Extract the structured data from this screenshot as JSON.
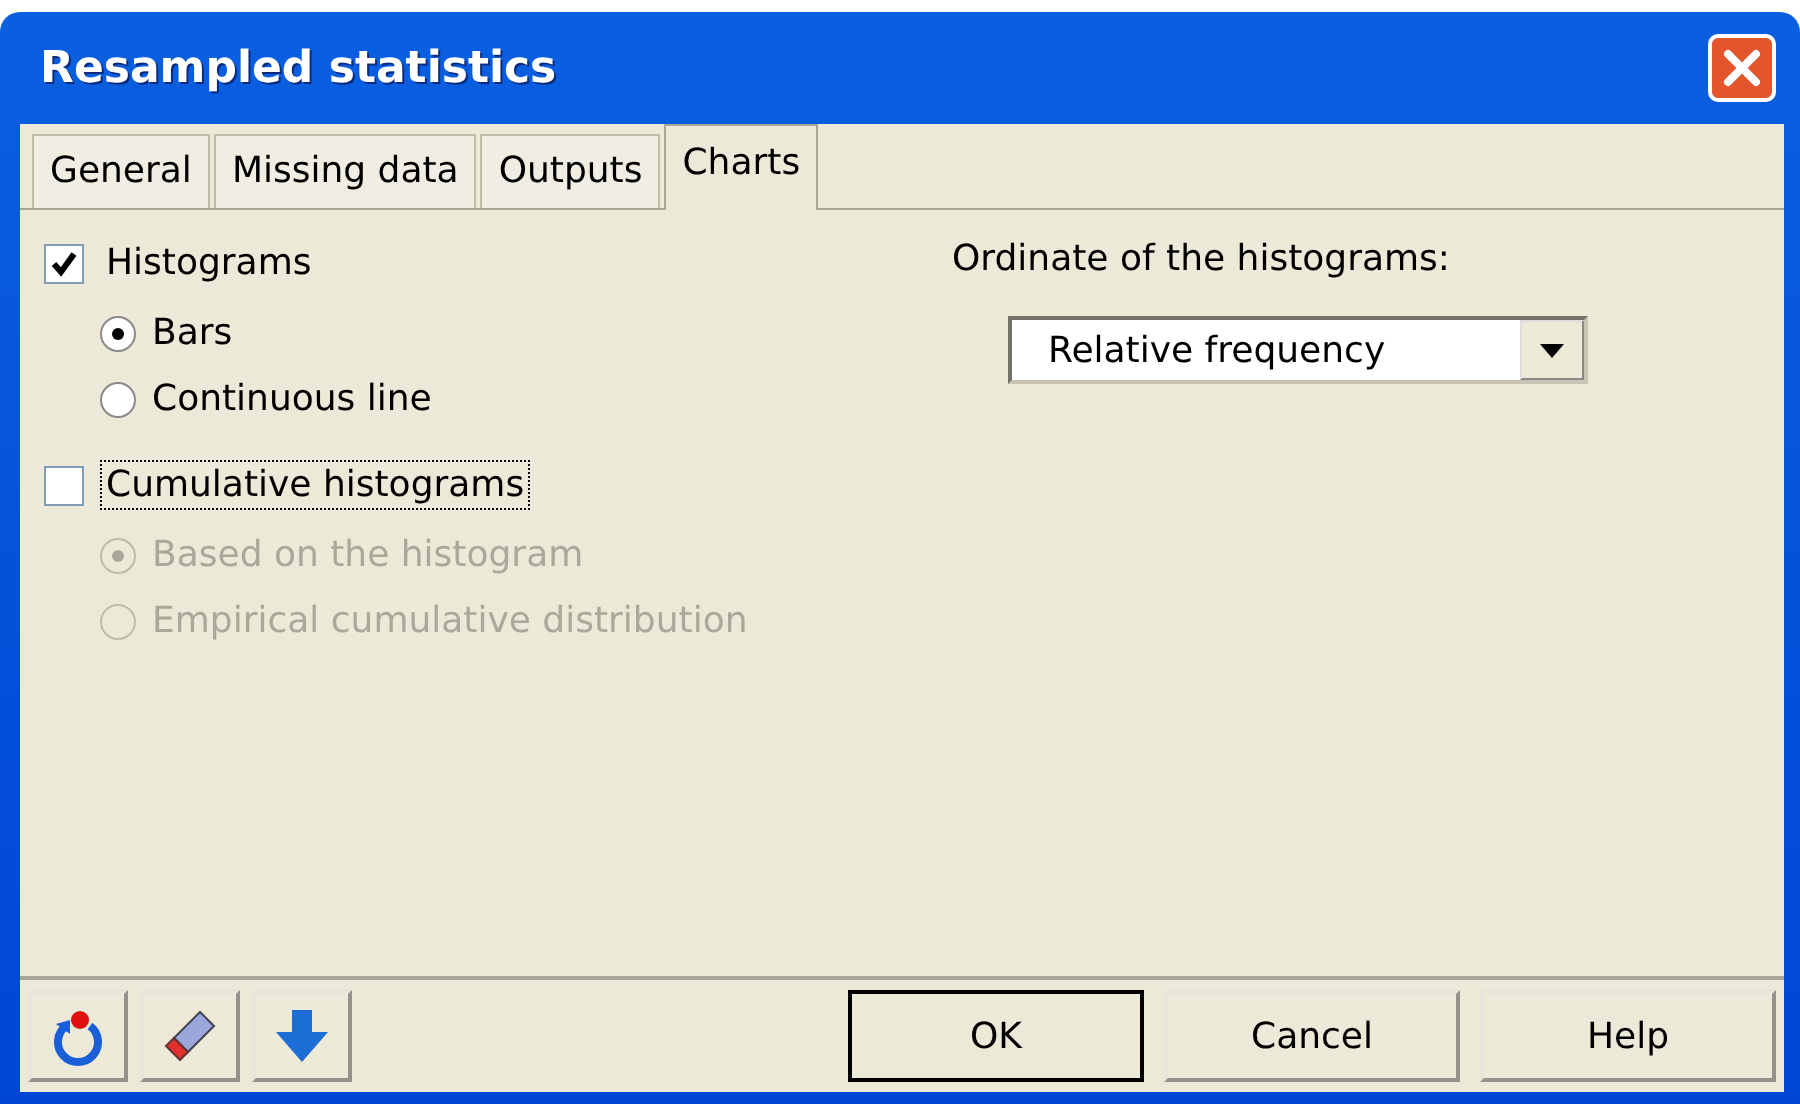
{
  "window": {
    "title": "Resampled statistics"
  },
  "tabs": [
    {
      "label": "General",
      "selected": false
    },
    {
      "label": "Missing data",
      "selected": false
    },
    {
      "label": "Outputs",
      "selected": false
    },
    {
      "label": "Charts",
      "selected": true
    }
  ],
  "groups": [
    {
      "label": "Histograms",
      "checked": true,
      "focused": false,
      "options": [
        {
          "label": "Bars",
          "selected": true,
          "disabled": false
        },
        {
          "label": "Continuous line",
          "selected": false,
          "disabled": false
        }
      ]
    },
    {
      "label": "Cumulative histograms",
      "checked": false,
      "focused": true,
      "options": [
        {
          "label": "Based on the histogram",
          "selected": true,
          "disabled": true
        },
        {
          "label": "Empirical cumulative distribution",
          "selected": false,
          "disabled": true
        }
      ]
    }
  ],
  "ordinate": {
    "label": "Ordinate of the histograms:",
    "value": "Relative frequency"
  },
  "tools": [
    {
      "kind": "reset"
    },
    {
      "kind": "eraser"
    },
    {
      "kind": "down"
    }
  ],
  "buttons": [
    {
      "label": "OK",
      "default": true
    },
    {
      "label": "Cancel",
      "default": false
    },
    {
      "label": "Help",
      "default": false
    }
  ]
}
